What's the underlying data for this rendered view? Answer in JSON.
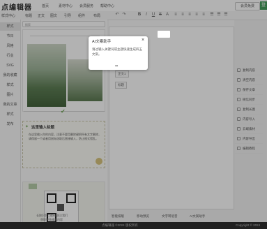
{
  "app": {
    "logo": "点编辑器"
  },
  "top_nav": [
    "首页",
    "素材中心",
    "会员服务",
    "帮助中心"
  ],
  "top_right": {
    "button_label": "会员免费",
    "green_label": "登"
  },
  "sub_nav": [
    "样式中心",
    "标题",
    "正文",
    "图文",
    "引导",
    "组件",
    "布局"
  ],
  "sidebar": {
    "items": [
      "样式",
      "节日",
      "风格",
      "行业",
      "SVG",
      "我的收藏",
      "样式",
      "图片",
      "我的文章",
      "样式",
      "发布"
    ]
  },
  "search": {
    "placeholder": "搜索"
  },
  "template": {
    "heading": "这里输入标题",
    "body_text": "在这里输入你的内容，注意不要用删除键把所有文字删除，请保留一个或者用鼠标选取后直接输入，防止格式错乱。",
    "qr_caption": "长按识别二维码 关注我们",
    "qr_caption2": "获取更多精彩内容"
  },
  "editor": {
    "tag_text": "正文1",
    "tag_title": "标题"
  },
  "toolbar": {
    "items": [
      "↶",
      "↷",
      "B",
      "I",
      "U",
      "S",
      "A",
      "≡",
      "≡",
      "≡",
      "≡",
      "≡",
      "☰",
      "☰",
      "☰"
    ]
  },
  "right_tools": [
    "复制内容",
    "清空内容",
    "保存文章",
    "微信同步",
    "复制长图",
    "内容导入",
    "云端素材",
    "内容导出",
    "编辑教程"
  ],
  "bottom_tools": [
    "智能排版",
    "移动预览",
    "文字转语音",
    "AI文案助手"
  ],
  "footer": {
    "left": "点编辑器 ©2024 版权所有",
    "right": "Copyright © 2024"
  },
  "popup": {
    "title": "AI文案助手",
    "close": "×",
    "body": "请过输入关键词或主题快速生成四五文案。",
    "loader": "•••"
  },
  "colors": {
    "accent_green": "#45a05d",
    "overlay": "rgba(0,0,0,0.30)"
  }
}
